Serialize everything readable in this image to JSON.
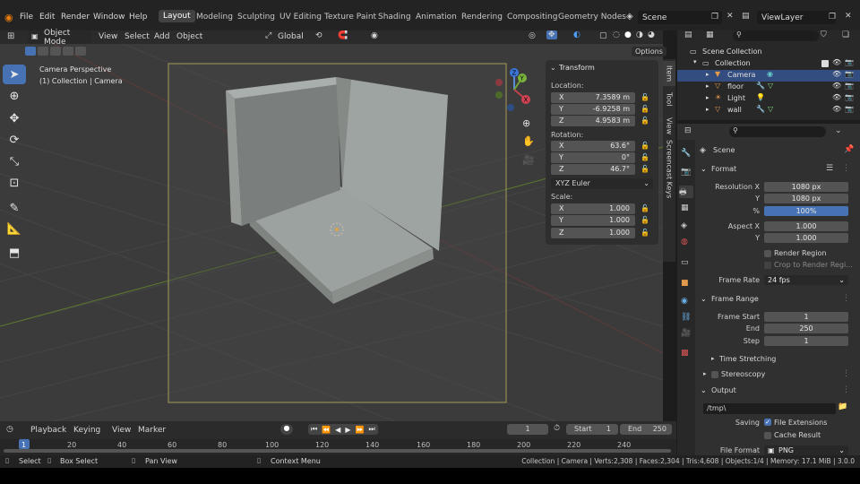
{
  "menubar": {
    "items": [
      "File",
      "Edit",
      "Render",
      "Window",
      "Help"
    ],
    "workspaces": [
      "Layout",
      "Modeling",
      "Sculpting",
      "UV Editing",
      "Texture Paint",
      "Shading",
      "Animation",
      "Rendering",
      "Compositing",
      "Geometry Nodes"
    ],
    "scene": "Scene",
    "view_layer": "ViewLayer"
  },
  "viewport_header": {
    "mode": "Object Mode",
    "menus": [
      "View",
      "Select",
      "Add",
      "Object"
    ],
    "orientation": "Global",
    "options": "Options"
  },
  "viewport": {
    "line1": "Camera Perspective",
    "line2": "(1) Collection | Camera"
  },
  "npanel": {
    "title": "Transform",
    "location_label": "Location:",
    "location": [
      {
        "ax": "X",
        "val": "7.3589 m"
      },
      {
        "ax": "Y",
        "val": "-6.9258 m"
      },
      {
        "ax": "Z",
        "val": "4.9583 m"
      }
    ],
    "rotation_label": "Rotation:",
    "rotation": [
      {
        "ax": "X",
        "val": "63.6°"
      },
      {
        "ax": "Y",
        "val": "0°"
      },
      {
        "ax": "Z",
        "val": "46.7°"
      }
    ],
    "rotation_mode": "XYZ Euler",
    "scale_label": "Scale:",
    "scale": [
      {
        "ax": "X",
        "val": "1.000"
      },
      {
        "ax": "Y",
        "val": "1.000"
      },
      {
        "ax": "Z",
        "val": "1.000"
      }
    ]
  },
  "vtabs": [
    "Item",
    "Tool",
    "View",
    "Screencast Keys"
  ],
  "outliner": {
    "scene_collection": "Scene Collection",
    "collection": "Collection",
    "items": [
      "Camera",
      "floor",
      "Light",
      "wall"
    ]
  },
  "properties": {
    "scene": "Scene",
    "format_title": "Format",
    "resolution_x_label": "Resolution X",
    "resolution_x": "1080 px",
    "y_label": "Y",
    "resolution_y": "1080 px",
    "pct_label": "%",
    "resolution_pct": "100%",
    "aspect_x_label": "Aspect X",
    "aspect_x": "1.000",
    "aspect_y": "1.000",
    "render_region": "Render Region",
    "crop_region": "Crop to Render Regi...",
    "frame_rate_label": "Frame Rate",
    "frame_rate": "24 fps",
    "frame_range_title": "Frame Range",
    "frame_start_label": "Frame Start",
    "frame_start": "1",
    "end_label": "End",
    "frame_end": "250",
    "step_label": "Step",
    "frame_step": "1",
    "time_stretching": "Time Stretching",
    "stereoscopy": "Stereoscopy",
    "output_title": "Output",
    "output_path": "/tmp\\",
    "saving_label": "Saving",
    "file_extensions": "File Extensions",
    "cache_result": "Cache Result",
    "file_format_label": "File Format",
    "file_format": "PNG"
  },
  "timeline": {
    "menus": [
      "Playback",
      "Keying",
      "View",
      "Marker"
    ],
    "current_frame": "1",
    "start_label": "Start",
    "start": "1",
    "end_label": "End",
    "end": "250",
    "ticks": [
      "1",
      "20",
      "40",
      "60",
      "80",
      "100",
      "120",
      "140",
      "160",
      "180",
      "200",
      "220",
      "240"
    ]
  },
  "statusbar": {
    "select": "Select",
    "box_select": "Box Select",
    "pan_view": "Pan View",
    "context_menu": "Context Menu",
    "stats": "Collection | Camera | Verts:2,308 | Faces:2,304 | Tris:4,608 | Objects:1/4 | Memory: 17.1 MiB | 3.0.0"
  }
}
